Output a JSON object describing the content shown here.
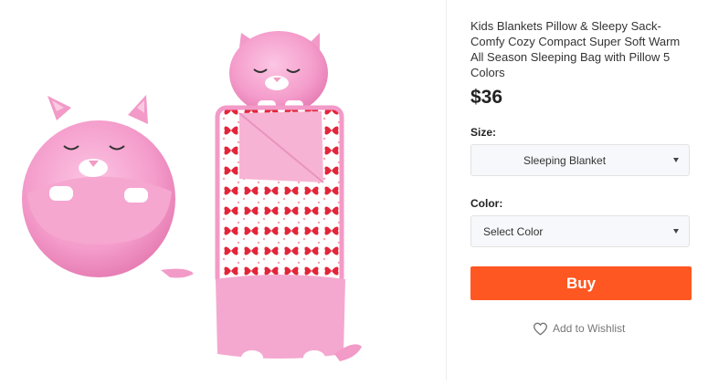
{
  "product": {
    "title": "Kids Blankets Pillow & Sleepy Sack-Comfy Cozy Compact Super Soft Warm All Season Sleeping Bag with Pillow 5 Colors",
    "price": "$36"
  },
  "options": {
    "size_label": "Size:",
    "size_value": "Sleeping Blanket",
    "color_label": "Color:",
    "color_value": "Select Color"
  },
  "actions": {
    "buy_label": "Buy",
    "wishlist_label": "Add to Wishlist"
  },
  "colors": {
    "buy_button": "#ff5722",
    "plush_pink": "#f7a3cf",
    "butterfly_red": "#e3253a"
  },
  "icons": {
    "wishlist": "heart-icon",
    "dropdown": "chevron-down-icon"
  }
}
